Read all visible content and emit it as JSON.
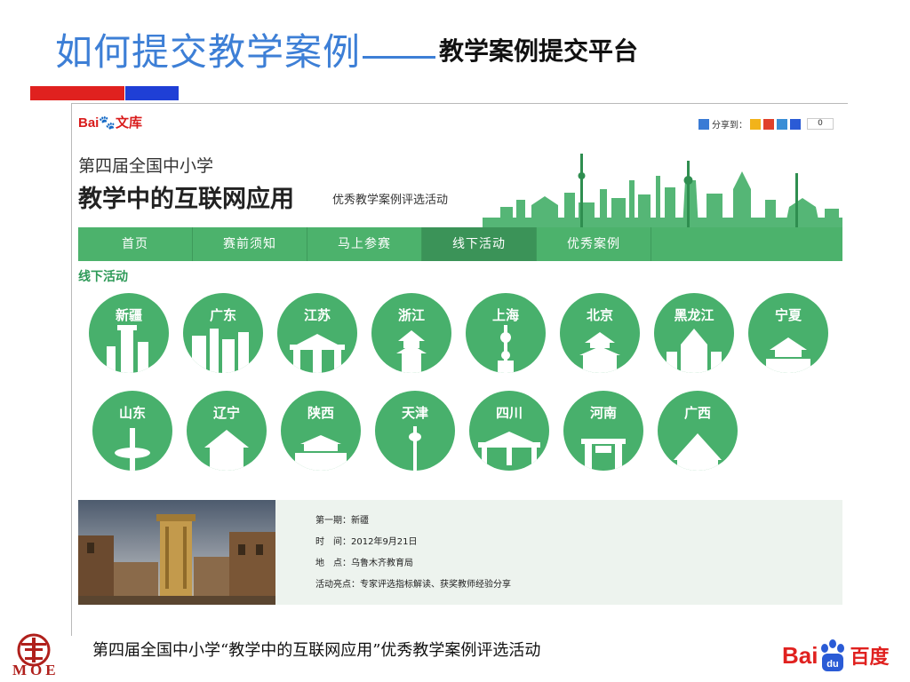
{
  "slide": {
    "title_main": "如何提交教学案例",
    "title_sub": "教学案例提交平台",
    "caption": "第四届全国中小学“教学中的互联网应用”优秀教学案例评选活动",
    "moe_text": "MOE",
    "baidu_bai": "Bai",
    "baidu_cn": "百度"
  },
  "web": {
    "logo_bai": "Bai",
    "logo_wk": "文库",
    "share_label": "分享到：",
    "share_count": "0",
    "banner_subtitle": "第四届全国中小学",
    "banner_title": "教学中的互联网应用",
    "banner_tag": "优秀教学案例评选活动",
    "nav": [
      {
        "label": "首页"
      },
      {
        "label": "赛前须知"
      },
      {
        "label": "马上参赛"
      },
      {
        "label": "线下活动",
        "active": true
      },
      {
        "label": "优秀案例"
      }
    ],
    "section_title": "线下活动",
    "cities": [
      "新疆",
      "广东",
      "江苏",
      "浙江",
      "上海",
      "北京",
      "黑龙江",
      "宁夏",
      "山东",
      "辽宁",
      "陕西",
      "天津",
      "四川",
      "河南",
      "广西"
    ],
    "activity": {
      "issue": "第一期：新疆",
      "time": "时　间：2012年9月21日",
      "place": "地　点：乌鲁木齐教育局",
      "highlights": "活动亮点：专家评选指标解读、获奖教师经验分享"
    }
  },
  "colors": {
    "title_blue": "#3d7fd6",
    "green": "#48b06c",
    "nav_active": "#3b9358",
    "red": "#e0211f",
    "blue_bar": "#1f3fd6"
  }
}
